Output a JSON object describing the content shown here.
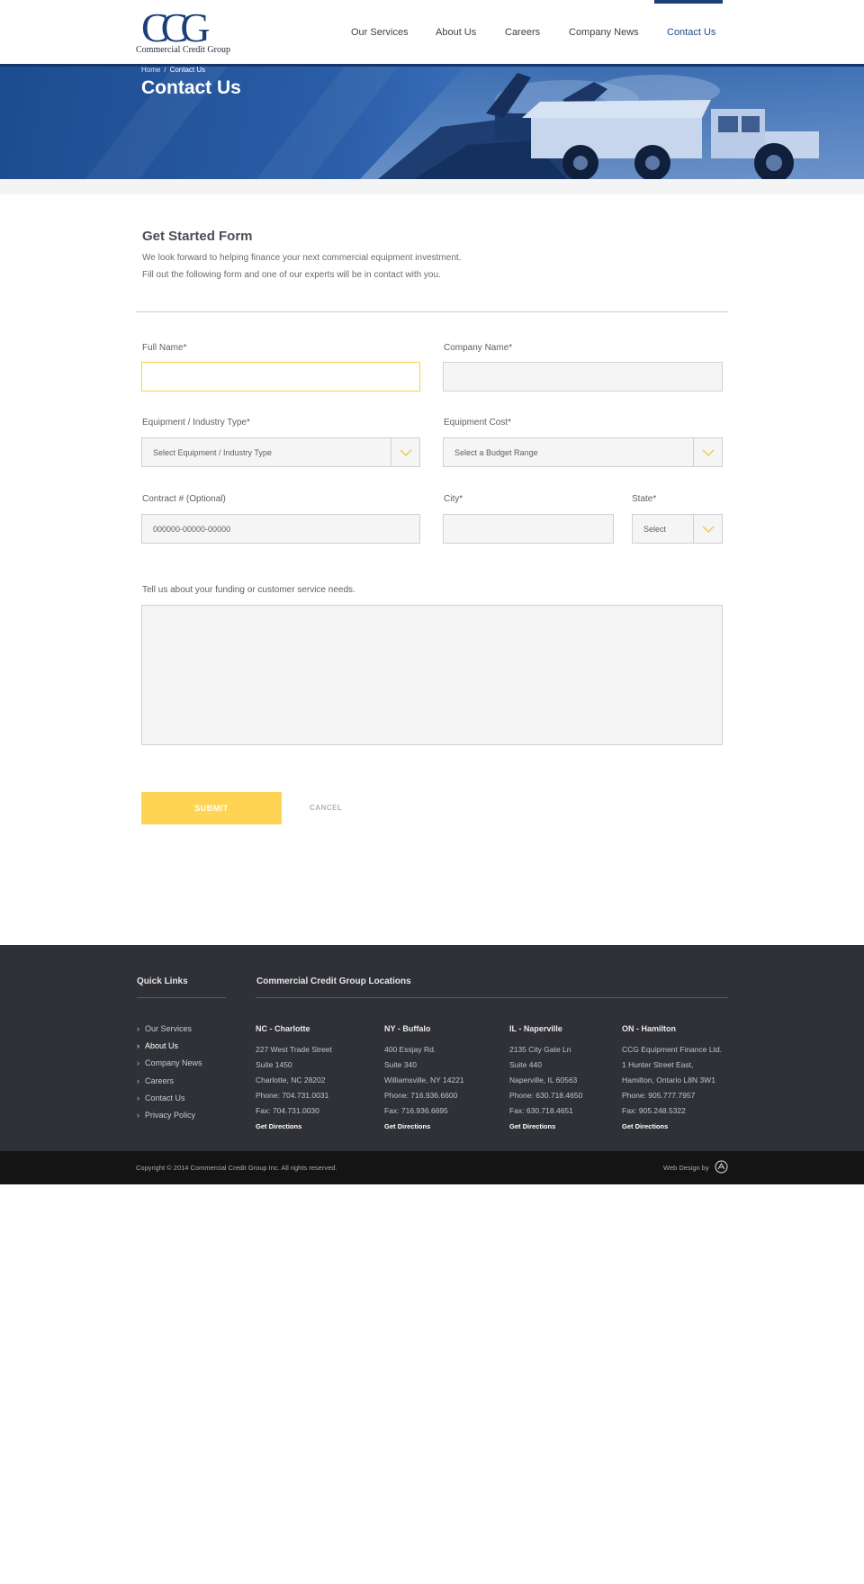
{
  "header": {
    "logo_letters": "CCG",
    "logo_tagline": "Commercial Credit Group",
    "nav": [
      {
        "label": "Our Services"
      },
      {
        "label": "About Us"
      },
      {
        "label": "Careers"
      },
      {
        "label": "Company News"
      },
      {
        "label": "Contact Us",
        "active": true
      }
    ]
  },
  "hero": {
    "breadcrumb_home": "Home",
    "breadcrumb_sep": "/",
    "breadcrumb_current": "Contact Us",
    "title": "Contact Us"
  },
  "intro": {
    "title": "Get Started Form",
    "line1": "We look forward to helping finance your next commercial equipment investment.",
    "line2": "Fill out the following form and one of our experts will be in contact with you."
  },
  "form": {
    "full_name_label": "Full Name*",
    "company_name_label": "Company Name*",
    "equipment_type_label": "Equipment / Industry Type*",
    "equipment_type_value": "Select  Equipment / Industry Type",
    "equipment_cost_label": "Equipment Cost*",
    "equipment_cost_value": "Select a Budget Range",
    "contract_label": "Contract # (Optional)",
    "contract_placeholder": "000000-00000-00000",
    "city_label": "City*",
    "state_label": "State*",
    "state_value": "Select",
    "needs_label": "Tell us about your funding or customer service needs.",
    "submit_label": "SUBMIT",
    "cancel_label": "CANCEL"
  },
  "footer": {
    "quick_links_heading": "Quick Links",
    "quick_links": [
      {
        "label": "Our Services"
      },
      {
        "label": "About Us",
        "active": true
      },
      {
        "label": "Company News"
      },
      {
        "label": "Careers"
      },
      {
        "label": "Contact Us"
      },
      {
        "label": "Privacy Policy"
      }
    ],
    "locations_heading": "Commercial Credit Group Locations",
    "locations": [
      {
        "name": "NC - Charlotte",
        "lines": [
          "227 West Trade Street",
          "Suite 1450",
          "Charlotte, NC 28202",
          "Phone: 704.731.0031",
          "Fax: 704.731.0030"
        ],
        "directions": "Get Directions"
      },
      {
        "name": "NY - Buffalo",
        "lines": [
          "400 Essjay Rd.",
          "Suite 340",
          "Williamsville, NY 14221",
          "Phone: 716.936.6600",
          "Fax: 716.936.6695"
        ],
        "directions": "Get Directions"
      },
      {
        "name": "IL - Naperville",
        "lines": [
          "2135 City Gate Ln",
          "Suite 440",
          "Naperville, IL 60563",
          "Phone: 630.718.4650",
          "Fax: 630.718.4651"
        ],
        "directions": "Get Directions"
      },
      {
        "name": "ON - Hamilton",
        "lines": [
          "CCG Equipment Finance Ltd.",
          "1 Hunter Street East,",
          "Hamilton, Ontario L8N 3W1",
          "Phone: 905.777.7957",
          "Fax: 905.248.5322"
        ],
        "directions": "Get Directions"
      }
    ],
    "copyright": "Copyright © 2014 Commercial Credit Group Inc. All rights reserved.",
    "web_design": "Web Design by"
  },
  "colors": {
    "brand_navy": "#1d3f78",
    "accent_yellow": "#ffd454",
    "footer_bg": "#303136",
    "bottom_bar": "#141414"
  }
}
